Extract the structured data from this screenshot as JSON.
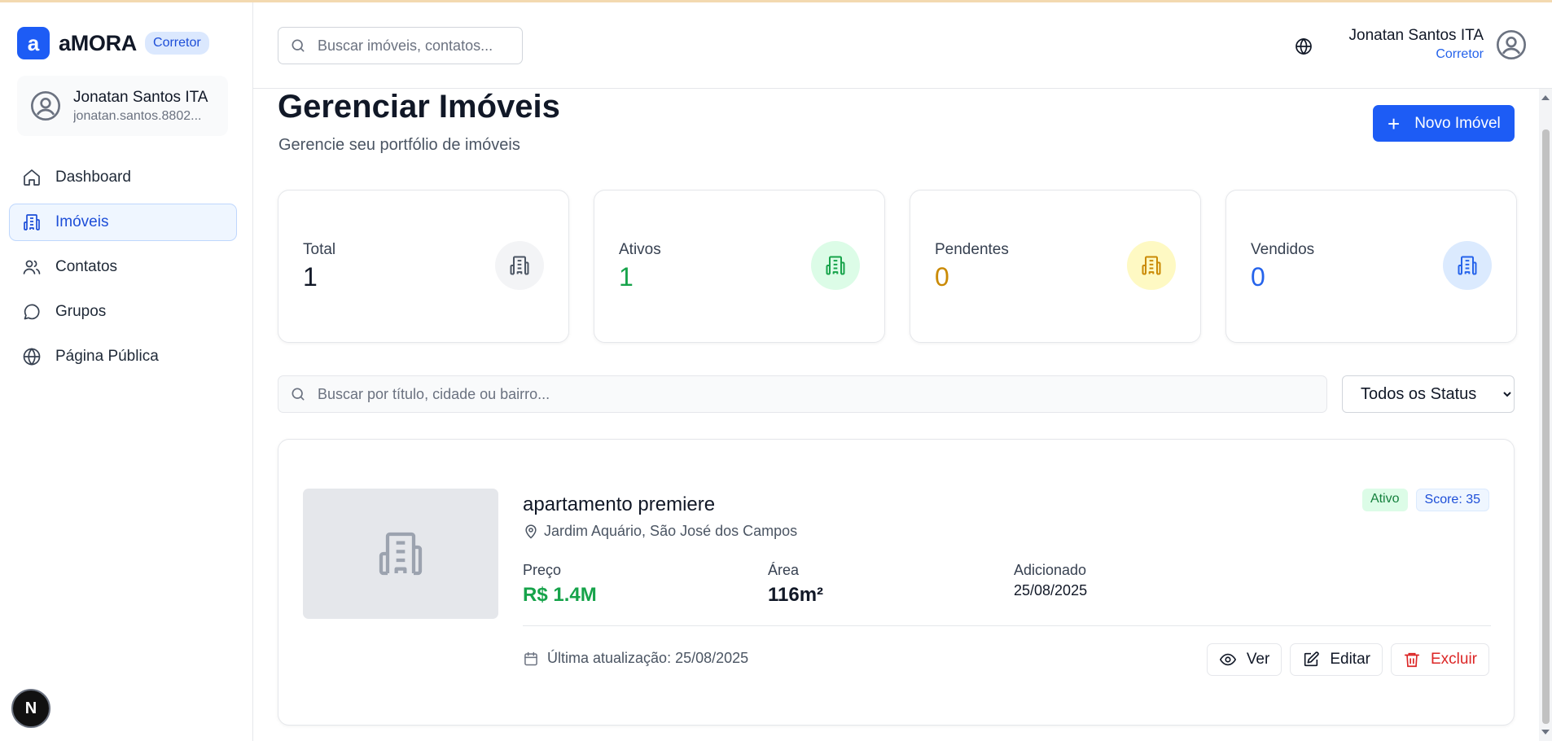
{
  "brand": {
    "logo_letter": "a",
    "name": "aMORA",
    "badge": "Corretor"
  },
  "sidebar": {
    "user": {
      "name": "Jonatan Santos ITA",
      "email": "jonatan.santos.8802..."
    },
    "items": [
      {
        "label": "Dashboard",
        "icon": "home-icon",
        "active": false
      },
      {
        "label": "Imóveis",
        "icon": "building-icon",
        "active": true
      },
      {
        "label": "Contatos",
        "icon": "users-icon",
        "active": false
      },
      {
        "label": "Grupos",
        "icon": "chat-bubble-icon",
        "active": false
      },
      {
        "label": "Página Pública",
        "icon": "globe-icon",
        "active": false
      }
    ],
    "bottom_badge": "N"
  },
  "header": {
    "search_placeholder": "Buscar imóveis, contatos...",
    "user_name": "Jonatan Santos ITA",
    "user_role": "Corretor"
  },
  "page": {
    "title": "Gerenciar Imóveis",
    "subtitle": "Gerencie seu portfólio de imóveis",
    "new_button": "Novo Imóvel"
  },
  "stats": [
    {
      "label": "Total",
      "value": "1",
      "color": "#111827",
      "bg": "#f3f4f6",
      "icon_color": "#4b5563"
    },
    {
      "label": "Ativos",
      "value": "1",
      "color": "#16a34a",
      "bg": "#dcfce7",
      "icon_color": "#16a34a"
    },
    {
      "label": "Pendentes",
      "value": "0",
      "color": "#ca8a04",
      "bg": "#fef9c3",
      "icon_color": "#ca8a04"
    },
    {
      "label": "Vendidos",
      "value": "0",
      "color": "#2563eb",
      "bg": "#dbeafe",
      "icon_color": "#2563eb"
    }
  ],
  "filters": {
    "search_placeholder": "Buscar por título, cidade ou bairro...",
    "status_options": [
      "Todos os Status"
    ]
  },
  "property": {
    "title": "apartamento premiere",
    "location": "Jardim Aquário, São José dos Campos",
    "status": "Ativo",
    "score": "Score: 35",
    "price_label": "Preço",
    "price_value": "R$ 1.4M",
    "area_label": "Área",
    "area_value": "116m²",
    "added_label": "Adicionado",
    "added_value": "25/08/2025",
    "updated": "Última atualização: 25/08/2025",
    "actions": {
      "view": "Ver",
      "edit": "Editar",
      "delete": "Excluir"
    }
  }
}
